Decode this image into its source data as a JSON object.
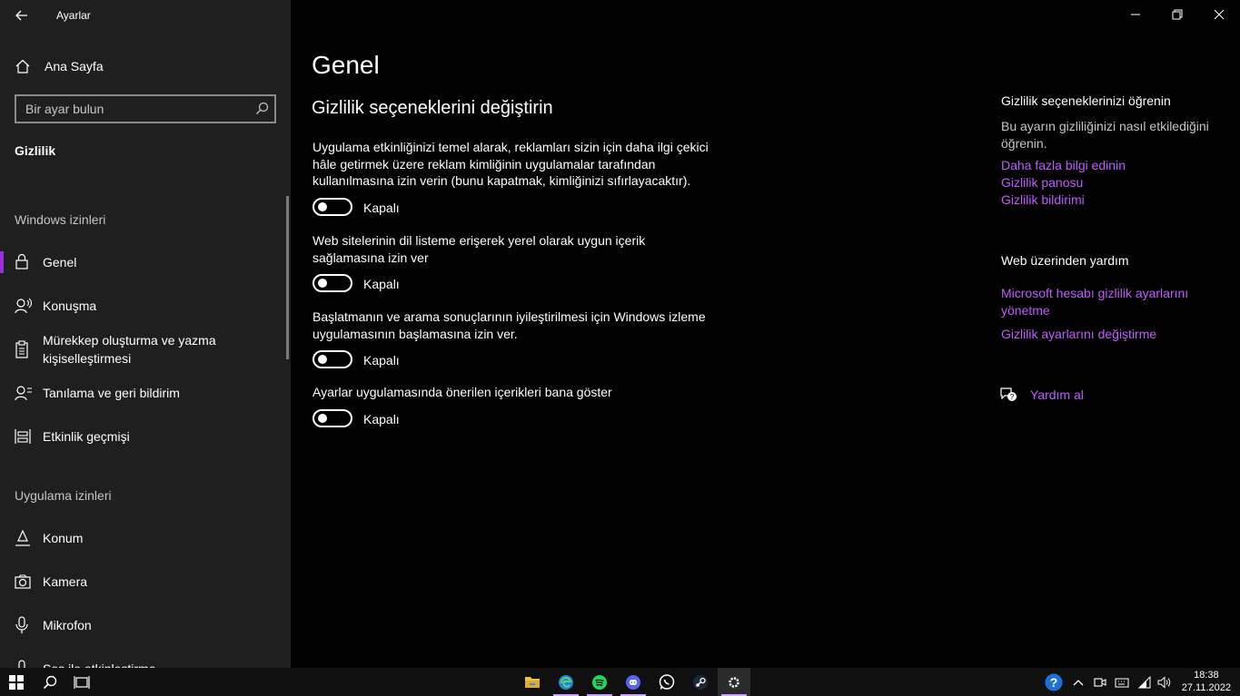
{
  "app": {
    "title": "Ayarlar"
  },
  "sidebar": {
    "home_label": "Ana Sayfa",
    "search_placeholder": "Bir ayar bulun",
    "category": "Gizlilik",
    "windows_section": "Windows izinleri",
    "windows_items": [
      {
        "label": "Genel",
        "icon": "lock-icon",
        "active": true
      },
      {
        "label": "Konuşma",
        "icon": "speech-icon"
      },
      {
        "label": "Mürekkep oluşturma ve yazma kişiselleştirmesi",
        "icon": "clipboard-icon"
      },
      {
        "label": "Tanılama ve geri bildirim",
        "icon": "feedback-icon"
      },
      {
        "label": "Etkinlik geçmişi",
        "icon": "timeline-icon"
      }
    ],
    "app_section": "Uygulama izinleri",
    "app_items": [
      {
        "label": "Konum",
        "icon": "location-icon"
      },
      {
        "label": "Kamera",
        "icon": "camera-icon"
      },
      {
        "label": "Mikrofon",
        "icon": "microphone-icon"
      },
      {
        "label": "Ses ile etkinleştirme",
        "icon": "voice-activation-icon"
      }
    ]
  },
  "main": {
    "page_title": "Genel",
    "section_title": "Gizlilik seçeneklerini değiştirin",
    "options": [
      {
        "description": "Uygulama etkinliğinizi temel alarak, reklamları sizin için daha ilgi çekici hâle getirmek üzere reklam kimliğinin uygulamalar tarafından kullanılmasına izin verin (bunu kapatmak, kimliğinizi sıfırlayacaktır).",
        "state": "Kapalı"
      },
      {
        "description": "Web sitelerinin dil listeme erişerek yerel olarak uygun içerik sağlamasına izin ver",
        "state": "Kapalı"
      },
      {
        "description": "Başlatmanın ve arama sonuçlarının iyileştirilmesi için Windows izleme uygulamasının başlamasına izin ver.",
        "state": "Kapalı"
      },
      {
        "description": "Ayarlar uygulamasında önerilen içerikleri bana göster",
        "state": "Kapalı"
      }
    ]
  },
  "right": {
    "learn_title": "Gizlilik seçeneklerinizi öğrenin",
    "learn_text": "Bu ayarın gizliliğinizi nasıl etkilediğini öğrenin.",
    "learn_links": [
      "Daha fazla bilgi edinin",
      "Gizlilik panosu",
      "Gizlilik bildirimi"
    ],
    "web_title": "Web üzerinden yardım",
    "web_links": [
      "Microsoft hesabı gizlilik ayarlarını yönetme",
      "Gizlilik ayarlarını değiştirme"
    ],
    "help_label": "Yardım al"
  },
  "taskbar": {
    "time": "18:38",
    "date": "27.11.2022"
  },
  "colors": {
    "accent": "#c05bff",
    "active_bar": "#9b30d9",
    "sidebar_bg": "#1f1f1f"
  }
}
